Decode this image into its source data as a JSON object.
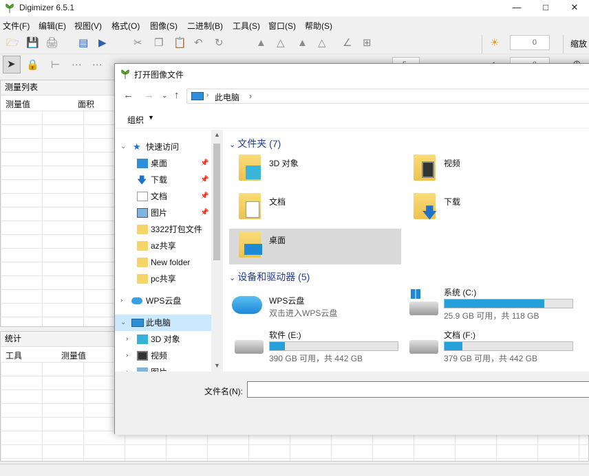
{
  "app": {
    "title": "Digimizer 6.5.1",
    "menu": [
      "文件(F)",
      "编辑(E)",
      "视图(V)",
      "格式(O)",
      "图像(S)",
      "二进制(B)",
      "工具(S)",
      "窗口(S)",
      "帮助(S)"
    ],
    "toolbar": {
      "brightness_value": "0",
      "contrast_value": "0",
      "thickness_value": "5",
      "zoom_label": "缩放"
    },
    "measure_panel": {
      "title": "测量列表",
      "columns": [
        "测量值",
        "面积"
      ]
    },
    "stats_panel": {
      "title": "统计",
      "columns": [
        "工具",
        "测量值"
      ]
    }
  },
  "dialog": {
    "title": "打开图像文件",
    "address": "此电脑",
    "organize_label": "组织",
    "nav": {
      "quick_access": "快速访问",
      "quick_items": [
        {
          "label": "桌面",
          "pinned": true,
          "icon": "desktop-icon"
        },
        {
          "label": "下载",
          "pinned": true,
          "icon": "download-icon"
        },
        {
          "label": "文档",
          "pinned": true,
          "icon": "document-icon"
        },
        {
          "label": "图片",
          "pinned": true,
          "icon": "picture-icon"
        },
        {
          "label": "3322打包文件",
          "pinned": false,
          "icon": "folder-icon"
        },
        {
          "label": "az共享",
          "pinned": false,
          "icon": "folder-icon"
        },
        {
          "label": "New folder",
          "pinned": false,
          "icon": "folder-icon"
        },
        {
          "label": "pc共享",
          "pinned": false,
          "icon": "folder-icon"
        }
      ],
      "wps_cloud": "WPS云盘",
      "this_pc": "此电脑",
      "pc_children": [
        "3D 对象",
        "视频",
        "图片"
      ]
    },
    "folders_header": "文件夹 (7)",
    "folders": [
      "3D 对象",
      "视频",
      "文档",
      "下载",
      "桌面"
    ],
    "devices_header": "设备和驱动器 (5)",
    "devices": [
      {
        "name": "WPS云盘",
        "sub": "双击进入WPS云盘",
        "type": "cloud"
      },
      {
        "name": "系统 (C:)",
        "sub": "25.9 GB 可用，共 118 GB",
        "used_fraction": 0.78,
        "type": "drive"
      },
      {
        "name": "软件 (E:)",
        "sub": "390 GB 可用，共 442 GB",
        "used_fraction": 0.12,
        "type": "drive"
      },
      {
        "name": "文档 (F:)",
        "sub": "379 GB 可用，共 442 GB",
        "used_fraction": 0.14,
        "type": "drive"
      }
    ],
    "filename_label": "文件名(N):",
    "filename_value": ""
  },
  "colors": {
    "accent": "#26a0da",
    "selection": "#cce8ff",
    "group_header": "#1e3d8f",
    "folder": "#f6d46a"
  }
}
